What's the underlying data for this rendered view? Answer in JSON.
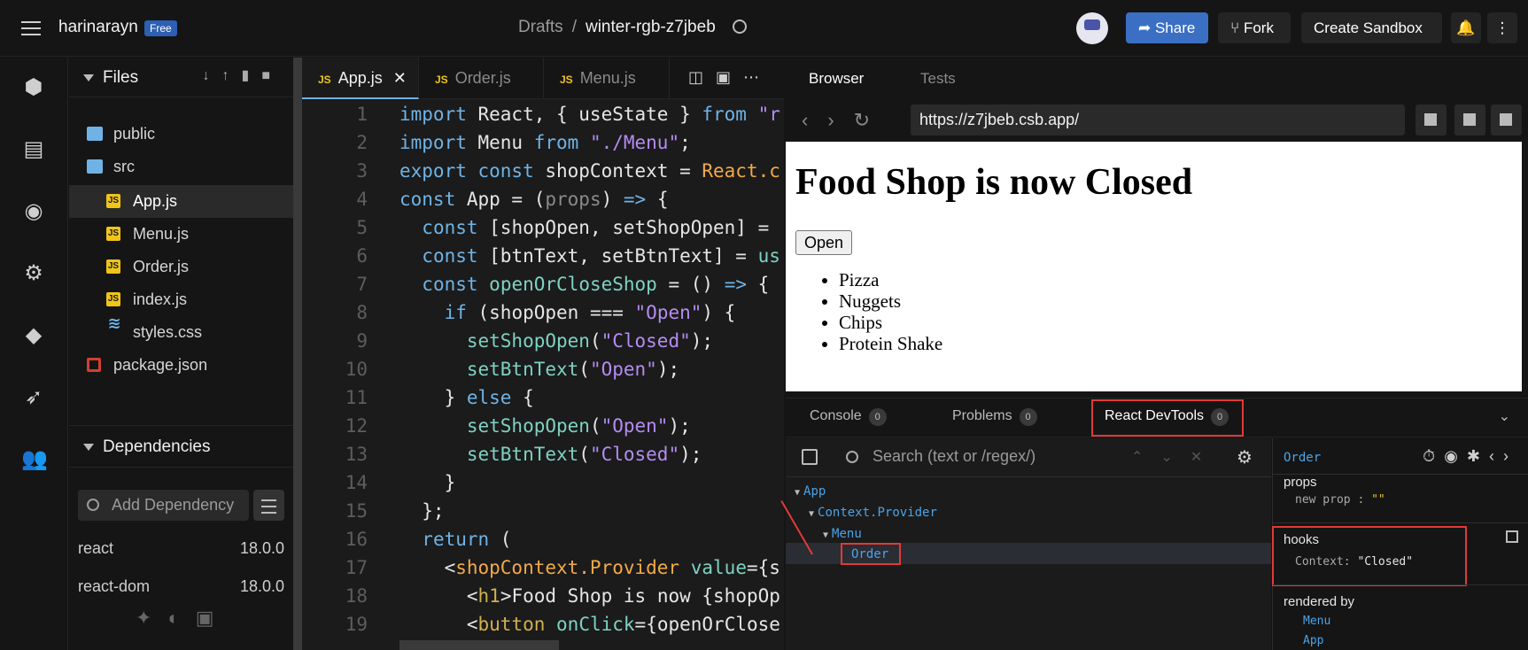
{
  "header": {
    "username": "harinarayn",
    "plan_badge": "Free",
    "breadcrumb_root": "Drafts",
    "breadcrumb_sep": "/",
    "sandbox_name": "winter-rgb-z7jbeb",
    "share_label": "Share",
    "fork_label": "Fork",
    "create_label": "Create Sandbox"
  },
  "activity_icons": [
    "box-icon",
    "file-icon",
    "search-icon",
    "gear-icon",
    "github-icon",
    "rocket-icon",
    "users-icon"
  ],
  "files": {
    "title": "Files",
    "tree": [
      {
        "label": "public",
        "type": "folder",
        "indent": 0
      },
      {
        "label": "src",
        "type": "folder-open",
        "indent": 0
      },
      {
        "label": "App.js",
        "type": "js",
        "indent": 1,
        "selected": true
      },
      {
        "label": "Menu.js",
        "type": "js",
        "indent": 1
      },
      {
        "label": "Order.js",
        "type": "js",
        "indent": 1
      },
      {
        "label": "index.js",
        "type": "js",
        "indent": 1
      },
      {
        "label": "styles.css",
        "type": "css",
        "indent": 1
      },
      {
        "label": "package.json",
        "type": "pkg",
        "indent": 0
      }
    ],
    "deps_title": "Dependencies",
    "deps_placeholder": "Add Dependency",
    "deps": [
      {
        "name": "react",
        "version": "18.0.0"
      },
      {
        "name": "react-dom",
        "version": "18.0.0"
      }
    ]
  },
  "editor": {
    "tabs": [
      {
        "label": "App.js",
        "active": true
      },
      {
        "label": "Order.js",
        "active": false
      },
      {
        "label": "Menu.js",
        "active": false
      }
    ],
    "lines": [
      "1",
      "2",
      "3",
      "4",
      "5",
      "6",
      "7",
      "8",
      "9",
      "10",
      "11",
      "12",
      "13",
      "14",
      "15",
      "16",
      "17",
      "18",
      "19"
    ]
  },
  "browser": {
    "tabs": [
      "Browser",
      "Tests"
    ],
    "url": "https://z7jbeb.csb.app/",
    "heading": "Food Shop is now Closed",
    "button": "Open",
    "items": [
      "Pizza",
      "Nuggets",
      "Chips",
      "Protein Shake"
    ]
  },
  "devtools": {
    "tabs": [
      {
        "label": "Console",
        "count": "0"
      },
      {
        "label": "Problems",
        "count": "0"
      },
      {
        "label": "React DevTools",
        "count": "0"
      }
    ],
    "search_placeholder": "Search (text or /regex/)",
    "tree": [
      "App",
      "Context.Provider",
      "Menu",
      "Order"
    ],
    "selected_component": "Order",
    "props_title": "props",
    "props_key": "new prop",
    "props_sep": ":",
    "props_value": "\"\"",
    "hooks_title": "hooks",
    "hooks_key": "Context:",
    "hooks_value": "\"Closed\"",
    "rendered_by_title": "rendered by",
    "rendered_by": [
      "Menu",
      "App"
    ]
  },
  "colors": {
    "accent_blue": "#3b6fc4",
    "highlight_red": "#e03a3a",
    "js_yellow": "#f0c419"
  }
}
